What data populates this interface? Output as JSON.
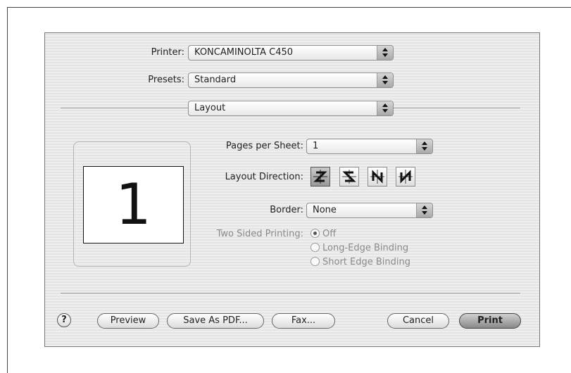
{
  "printer": {
    "label": "Printer:",
    "value": "KONCAMINOLTA C450"
  },
  "presets": {
    "label": "Presets:",
    "value": "Standard"
  },
  "panel": {
    "value": "Layout"
  },
  "preview": {
    "page_number": "1"
  },
  "layout": {
    "pages_per_sheet_label": "Pages per Sheet:",
    "pages_per_sheet_value": "1",
    "direction_label": "Layout Direction:",
    "directions": [
      "z-order",
      "reverse-z-order",
      "n-order",
      "reverse-n-order"
    ],
    "selected_direction": "z-order",
    "border_label": "Border:",
    "border_value": "None"
  },
  "two_sided": {
    "label": "Two Sided Printing:",
    "options": [
      "Off",
      "Long-Edge Binding",
      "Short Edge Binding"
    ],
    "selected": "Off"
  },
  "buttons": {
    "help": "?",
    "preview": "Preview",
    "save_pdf": "Save As PDF...",
    "fax": "Fax...",
    "cancel": "Cancel",
    "print": "Print"
  }
}
